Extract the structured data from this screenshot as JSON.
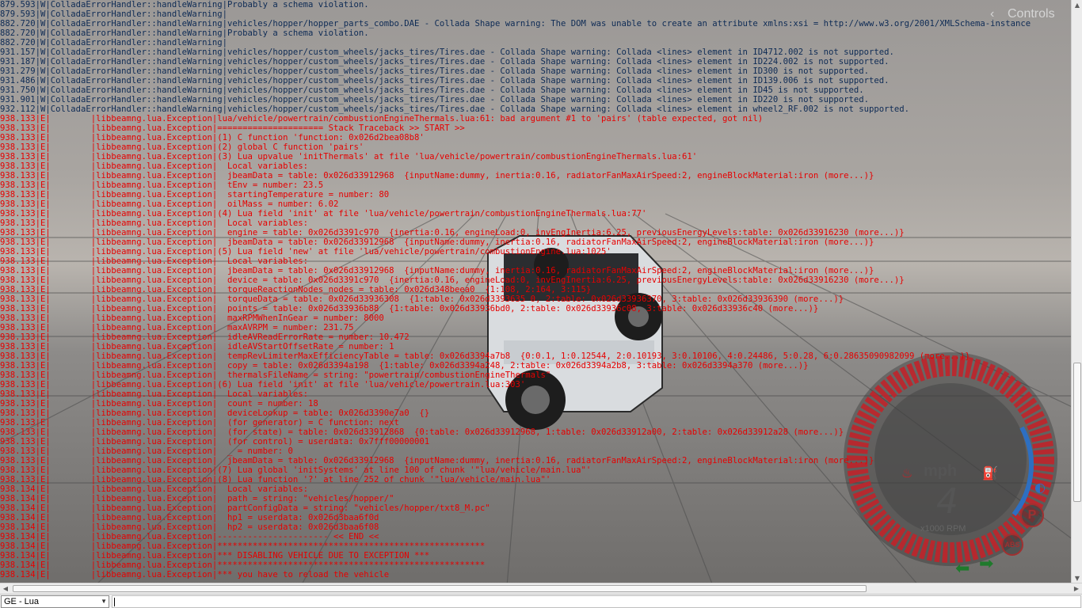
{
  "controls_label": "Controls",
  "console_lines": [
    {
      "t": "879.593|W|ColladaErrorHandler::handleWarning|Probably a schema violation.",
      "c": "w"
    },
    {
      "t": "879.593|W|ColladaErrorHandler::handleWarning|",
      "c": "w"
    },
    {
      "t": "882.720|W|ColladaErrorHandler::handleWarning|vehicles/hopper/hopper_parts_combo.DAE - Collada Shape warning: The DOM was unable to create an attribute xmlns:xsi = http://www.w3.org/2001/XMLSchema-instance",
      "c": "w"
    },
    {
      "t": "882.720|W|ColladaErrorHandler::handleWarning|Probably a schema violation.",
      "c": "w"
    },
    {
      "t": "882.720|W|ColladaErrorHandler::handleWarning|",
      "c": "w"
    },
    {
      "t": "931.157|W|ColladaErrorHandler::handleWarning|vehicles/hopper/custom_wheels/jacks_tires/Tires.dae - Collada Shape warning: Collada <lines> element in ID4712.002 is not supported.",
      "c": "w"
    },
    {
      "t": "931.187|W|ColladaErrorHandler::handleWarning|vehicles/hopper/custom_wheels/jacks_tires/Tires.dae - Collada Shape warning: Collada <lines> element in ID224.002 is not supported.",
      "c": "w"
    },
    {
      "t": "931.279|W|ColladaErrorHandler::handleWarning|vehicles/hopper/custom_wheels/jacks_tires/Tires.dae - Collada Shape warning: Collada <lines> element in ID300 is not supported.",
      "c": "w"
    },
    {
      "t": "931.486|W|ColladaErrorHandler::handleWarning|vehicles/hopper/custom_wheels/jacks_tires/Tires.dae - Collada Shape warning: Collada <lines> element in ID139.006 is not supported.",
      "c": "w"
    },
    {
      "t": "931.750|W|ColladaErrorHandler::handleWarning|vehicles/hopper/custom_wheels/jacks_tires/Tires.dae - Collada Shape warning: Collada <lines> element in ID45 is not supported.",
      "c": "w"
    },
    {
      "t": "931.901|W|ColladaErrorHandler::handleWarning|vehicles/hopper/custom_wheels/jacks_tires/Tires.dae - Collada Shape warning: Collada <lines> element in ID220 is not supported.",
      "c": "w"
    },
    {
      "t": "932.112|W|ColladaErrorHandler::handleWarning|vehicles/hopper/custom_wheels/jacks_tires/Tires.dae - Collada Shape warning: Collada <lines> element in wheel2_RF.002 is not supported.",
      "c": "w"
    },
    {
      "t": "938.133|E|        |libbeamng.lua.Exception|lua/vehicle/powertrain/combustionEngineThermals.lua:61: bad argument #1 to 'pairs' (table expected, got nil)",
      "c": "e"
    },
    {
      "t": "938.133|E|        |libbeamng.lua.Exception|===================== Stack Traceback >> START >>",
      "c": "e"
    },
    {
      "t": "938.133|E|        |libbeamng.lua.Exception|(1) C function 'function: 0x026d2bea08b8'",
      "c": "e"
    },
    {
      "t": "938.133|E|        |libbeamng.lua.Exception|(2) global C function 'pairs'",
      "c": "e"
    },
    {
      "t": "938.133|E|        |libbeamng.lua.Exception|(3) Lua upvalue 'initThermals' at file 'lua/vehicle/powertrain/combustionEngineThermals.lua:61'",
      "c": "e"
    },
    {
      "t": "938.133|E|        |libbeamng.lua.Exception|  Local variables:",
      "c": "e"
    },
    {
      "t": "938.133|E|        |libbeamng.lua.Exception|  jbeamData = table: 0x026d33912968  {inputName:dummy, inertia:0.16, radiatorFanMaxAirSpeed:2, engineBlockMaterial:iron (more...)}",
      "c": "e"
    },
    {
      "t": "938.133|E|        |libbeamng.lua.Exception|  tEnv = number: 23.5",
      "c": "e"
    },
    {
      "t": "938.133|E|        |libbeamng.lua.Exception|  startingTemperature = number: 80",
      "c": "e"
    },
    {
      "t": "938.133|E|        |libbeamng.lua.Exception|  oilMass = number: 6.02",
      "c": "e"
    },
    {
      "t": "938.133|E|        |libbeamng.lua.Exception|(4) Lua field 'init' at file 'lua/vehicle/powertrain/combustionEngineThermals.lua:77'",
      "c": "e"
    },
    {
      "t": "938.133|E|        |libbeamng.lua.Exception|  Local variables:",
      "c": "e"
    },
    {
      "t": "938.133|E|        |libbeamng.lua.Exception|  engine = table: 0x026d3391c970  {inertia:0.16, engineLoad:0, invEngInertia:6.25, previousEnergyLevels:table: 0x026d33916230 (more...)}",
      "c": "e"
    },
    {
      "t": "938.133|E|        |libbeamng.lua.Exception|  jbeamData = table: 0x026d33912968  {inputName:dummy, inertia:0.16, radiatorFanMaxAirSpeed:2, engineBlockMaterial:iron (more...)}",
      "c": "e"
    },
    {
      "t": "938.133|E|        |libbeamng.lua.Exception|(5) Lua field 'new' at file 'lua/vehicle/powertrain/combustionEngine.lua:1025'",
      "c": "e"
    },
    {
      "t": "938.133|E|        |libbeamng.lua.Exception|  Local variables:",
      "c": "e"
    },
    {
      "t": "938.133|E|        |libbeamng.lua.Exception|  jbeamData = table: 0x026d33912968  {inputName:dummy, inertia:0.16, radiatorFanMaxAirSpeed:2, engineBlockMaterial:iron (more...)}",
      "c": "e"
    },
    {
      "t": "938.133|E|        |libbeamng.lua.Exception|  device = table: 0x026d3391c970  {inertia:0.16, engineLoad:0, invEngInertia:6.25, previousEnergyLevels:table: 0x026d33916230 (more...)}",
      "c": "e"
    },
    {
      "t": "938.133|E|        |libbeamng.lua.Exception|  torqueReactionNodes_nodes = table: 0x026d348beea0  {1:108, 2:164, 3:115}",
      "c": "e"
    },
    {
      "t": "938.133|E|        |libbeamng.lua.Exception|  torqueData = table: 0x026d33936308  {1:table: 0x026d3393635 0, 2:table: 0x026d33936370, 3:table: 0x026d33936390 (more...)}",
      "c": "e"
    },
    {
      "t": "938.133|E|        |libbeamng.lua.Exception|  points = table: 0x026d33936b88  {1:table: 0x026d33936bd0, 2:table: 0x026d33936c08, 3:table: 0x026d33936c40 (more...)}",
      "c": "e"
    },
    {
      "t": "938.133|E|        |libbeamng.lua.Exception|  maxRPMWhenInGear = number: 8000",
      "c": "e"
    },
    {
      "t": "938.133|E|        |libbeamng.lua.Exception|  maxAVRPM = number: 231.75",
      "c": "e"
    },
    {
      "t": "938.133|E|        |libbeamng.lua.Exception|  idleAVReadErrorRate = number: 10.472",
      "c": "e"
    },
    {
      "t": "938.133|E|        |libbeamng.lua.Exception|  idleAVStartOffsetRate = number: 1",
      "c": "e"
    },
    {
      "t": "938.133|E|        |libbeamng.lua.Exception|  tempRevLimiterMaxEfficiencyTable = table: 0x026d3394a7b8  {0:0.1, 1:0.12544, 2:0.10193, 3:0.10106, 4:0.24486, 5:0.28, 6:0.28635090982099 (more...)}",
      "c": "e"
    },
    {
      "t": "938.133|E|        |libbeamng.lua.Exception|  copy = table: 0x026d3394a198  {1:table: 0x026d3394a248, 2:table: 0x026d3394a2b8, 3:table: 0x026d3394a370 (more...)}",
      "c": "e"
    },
    {
      "t": "938.133|E|        |libbeamng.lua.Exception|  thermalsFileName = string: \"powertrain/combustionEngineThermals\"",
      "c": "e"
    },
    {
      "t": "938.133|E|        |libbeamng.lua.Exception|(6) Lua field 'init' at file 'lua/vehicle/powertrain.lua:303'",
      "c": "e"
    },
    {
      "t": "938.133|E|        |libbeamng.lua.Exception|  Local variables:",
      "c": "e"
    },
    {
      "t": "938.133|E|        |libbeamng.lua.Exception|  count = number: 18",
      "c": "e"
    },
    {
      "t": "938.133|E|        |libbeamng.lua.Exception|  deviceLookup = table: 0x026d3390e7a0  {}",
      "c": "e"
    },
    {
      "t": "938.133|E|        |libbeamng.lua.Exception|  (for generator) = C function: next",
      "c": "e"
    },
    {
      "t": "938.133|E|        |libbeamng.lua.Exception|  (for state) = table: 0x026d33912868  {0:table: 0x026d33912968, 1:table: 0x026d33912a00, 2:table: 0x026d33912a28 (more...)}",
      "c": "e"
    },
    {
      "t": "938.133|E|        |libbeamng.lua.Exception|  (for control) = userdata: 0x7fff00000001",
      "c": "e"
    },
    {
      "t": "938.133|E|        |libbeamng.lua.Exception|  _ = number: 0",
      "c": "e"
    },
    {
      "t": "938.133|E|        |libbeamng.lua.Exception|  jbeamData = table: 0x026d33912968  {inputName:dummy, inertia:0.16, radiatorFanMaxAirSpeed:2, engineBlockMaterial:iron (more...)}",
      "c": "e"
    },
    {
      "t": "938.133|E|        |libbeamng.lua.Exception|(7) Lua global 'initSystems' at line 100 of chunk '\"lua/vehicle/main.lua\"'",
      "c": "e"
    },
    {
      "t": "938.133|E|        |libbeamng.lua.Exception|(8) Lua function '?' at line 252 of chunk '\"lua/vehicle/main.lua\"'",
      "c": "e"
    },
    {
      "t": "938.134|E|        |libbeamng.lua.Exception|  Local variables:",
      "c": "e"
    },
    {
      "t": "938.134|E|        |libbeamng.lua.Exception|  path = string: \"vehicles/hopper/\"",
      "c": "e"
    },
    {
      "t": "938.134|E|        |libbeamng.lua.Exception|  partConfigData = string: \"vehicles/hopper/txt8_M.pc\"",
      "c": "e"
    },
    {
      "t": "938.134|E|        |libbeamng.lua.Exception|  hp1 = userdata: 0x026d3baa6f0d",
      "c": "e"
    },
    {
      "t": "938.134|E|        |libbeamng.lua.Exception|  hp2 = userdata: 0x026d3baa6f08",
      "c": "e"
    },
    {
      "t": "938.134|E|        |libbeamng.lua.Exception|---------------------- << END <<",
      "c": "e"
    },
    {
      "t": "938.134|E|        |libbeamng.lua.Exception|*****************************************************",
      "c": "e"
    },
    {
      "t": "938.134|E|        |libbeamng.lua.Exception|*** DISABLING VEHICLE DUE TO EXCEPTION ***",
      "c": "e"
    },
    {
      "t": "938.134|E|        |libbeamng.lua.Exception|*****************************************************",
      "c": "e"
    },
    {
      "t": "938.134|E|        |libbeamng.lua.Exception|*** you have to reload the vehicle",
      "c": "e"
    }
  ],
  "dashboard": {
    "speed_unit": "mph",
    "gear": "4",
    "rpm_label": "x1000 RPM",
    "abs_label": "ABS",
    "park_label": "P"
  },
  "context_select": {
    "value": "GE - Lua"
  },
  "command_input": {
    "value": ""
  },
  "colors": {
    "warning_text": "#0e2b55",
    "error_text": "#e60000",
    "gauge_red": "#c0242a",
    "indicator_green": "#1f7a2c"
  }
}
